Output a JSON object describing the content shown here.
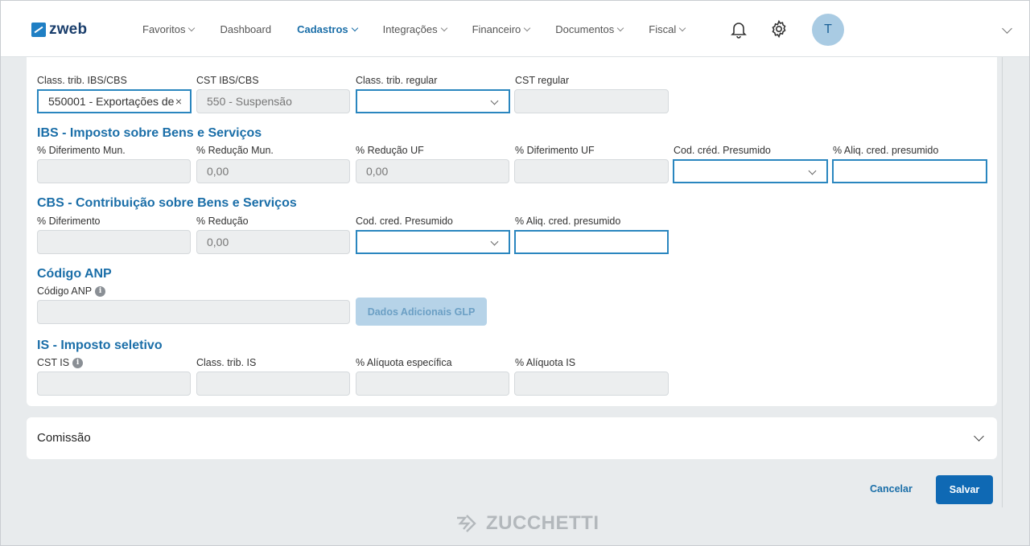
{
  "header": {
    "logo_text": "zweb",
    "nav": [
      {
        "label": "Favoritos",
        "has_dropdown": true,
        "active": false
      },
      {
        "label": "Dashboard",
        "has_dropdown": false,
        "active": false
      },
      {
        "label": "Cadastros",
        "has_dropdown": true,
        "active": true
      },
      {
        "label": "Integrações",
        "has_dropdown": true,
        "active": false
      },
      {
        "label": "Financeiro",
        "has_dropdown": true,
        "active": false
      },
      {
        "label": "Documentos",
        "has_dropdown": true,
        "active": false
      },
      {
        "label": "Fiscal",
        "has_dropdown": true,
        "active": false
      }
    ],
    "icons": [
      "bell-icon",
      "gear-icon",
      "chevron-down-icon"
    ],
    "avatar_initial": "T"
  },
  "form": {
    "class_trib_ibs_cbs": {
      "label": "Class. trib. IBS/CBS",
      "value": "550001 - Exportações de"
    },
    "cst_ibs_cbs": {
      "label": "CST IBS/CBS",
      "value": "550 - Suspensão"
    },
    "class_trib_regular": {
      "label": "Class. trib. regular",
      "value": ""
    },
    "cst_regular": {
      "label": "CST regular",
      "value": ""
    },
    "ibs": {
      "title": "IBS - Imposto sobre Bens e Serviços",
      "diferimento_mun": {
        "label": "% Diferimento Mun.",
        "value": ""
      },
      "reducao_mun": {
        "label": "% Redução Mun.",
        "value": "0,00"
      },
      "reducao_uf": {
        "label": "% Redução UF",
        "value": "0,00"
      },
      "diferimento_uf": {
        "label": "% Diferimento UF",
        "value": ""
      },
      "cod_cred_presumido": {
        "label": "Cod. créd. Presumido",
        "value": ""
      },
      "aliq_cred_presumido": {
        "label": "% Aliq. cred. presumido",
        "value": ""
      }
    },
    "cbs": {
      "title": "CBS - Contribuição sobre Bens e Serviços",
      "diferimento": {
        "label": "% Diferimento",
        "value": ""
      },
      "reducao": {
        "label": "% Redução",
        "value": "0,00"
      },
      "cod_cred_presumido": {
        "label": "Cod. cred. Presumido",
        "value": ""
      },
      "aliq_cred_presumido": {
        "label": "% Aliq. cred. presumido",
        "value": ""
      }
    },
    "anp": {
      "title": "Código ANP",
      "codigo": {
        "label": "Código ANP",
        "value": ""
      },
      "glp_button": "Dados Adicionais GLP"
    },
    "is": {
      "title": "IS - Imposto seletivo",
      "cst": {
        "label": "CST IS",
        "value": ""
      },
      "class_trib": {
        "label": "Class. trib. IS",
        "value": ""
      },
      "aliquota_especifica": {
        "label": "% Alíquota específica",
        "value": ""
      },
      "aliquota": {
        "label": "% Alíquota IS",
        "value": ""
      }
    }
  },
  "comissao": {
    "title": "Comissão"
  },
  "actions": {
    "cancel": "Cancelar",
    "save": "Salvar"
  },
  "footer": {
    "brand": "ZUCCHETTI"
  },
  "colors": {
    "accent": "#1a6ea8",
    "primary_button": "#0f69b4",
    "focus_border": "#2a86bf"
  }
}
